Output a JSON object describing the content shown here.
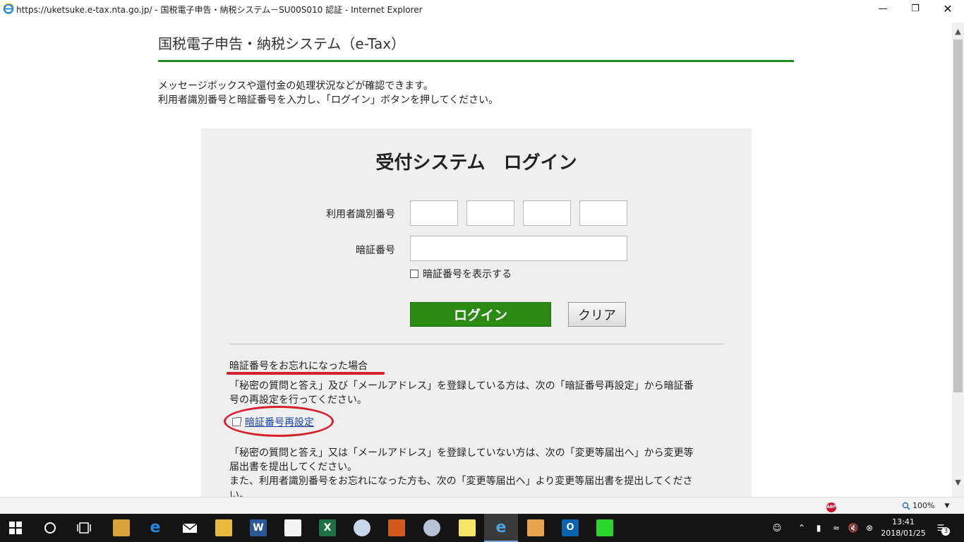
{
  "window": {
    "title": "https://uketsuke.e-tax.nta.go.jp/ - 国税電子申告・納税システム－SU00S010 認証 - Internet Explorer"
  },
  "page": {
    "site_title": "国税電子申告・納税システム（e-Tax）",
    "intro_line1": "メッセージボックスや還付金の処理状況などが確認できます。",
    "intro_line2": "利用者識別番号と暗証番号を入力し、「ログイン」ボタンを押してください。"
  },
  "login": {
    "title": "受付システム　ログイン",
    "user_id_label": "利用者識別番号",
    "password_label": "暗証番号",
    "show_password_label": "暗証番号を表示する",
    "login_button": "ログイン",
    "clear_button": "クリア"
  },
  "forgot": {
    "heading": "暗証番号をお忘れになった場合",
    "para1_line1": "「秘密の質問と答え」及び「メールアドレス」を登録している方は、次の「暗証番号再設定」から暗証番",
    "para1_line2": "号の再設定を行ってください。",
    "reset_link": "暗証番号再設定",
    "para2_line1": "「秘密の質問と答え」又は「メールアドレス」を登録していない方は、次の「変更等届出へ」から変更等",
    "para2_line2": "届出書を提出してください。",
    "para3_line1": "また、利用者識別番号をお忘れになった方も、次の「変更等届出へ」より変更等届出書を提出してくださ",
    "para3_line2": "い。"
  },
  "statusbar": {
    "abp_label": "ABP",
    "zoom": "100%"
  },
  "taskbar": {
    "time": "13:41",
    "date": "2018/01/25",
    "notification_count": "3"
  },
  "colors": {
    "accent_green": "#2a8a12",
    "annotation_red": "#d4212d",
    "link_blue": "#1a44a8"
  }
}
